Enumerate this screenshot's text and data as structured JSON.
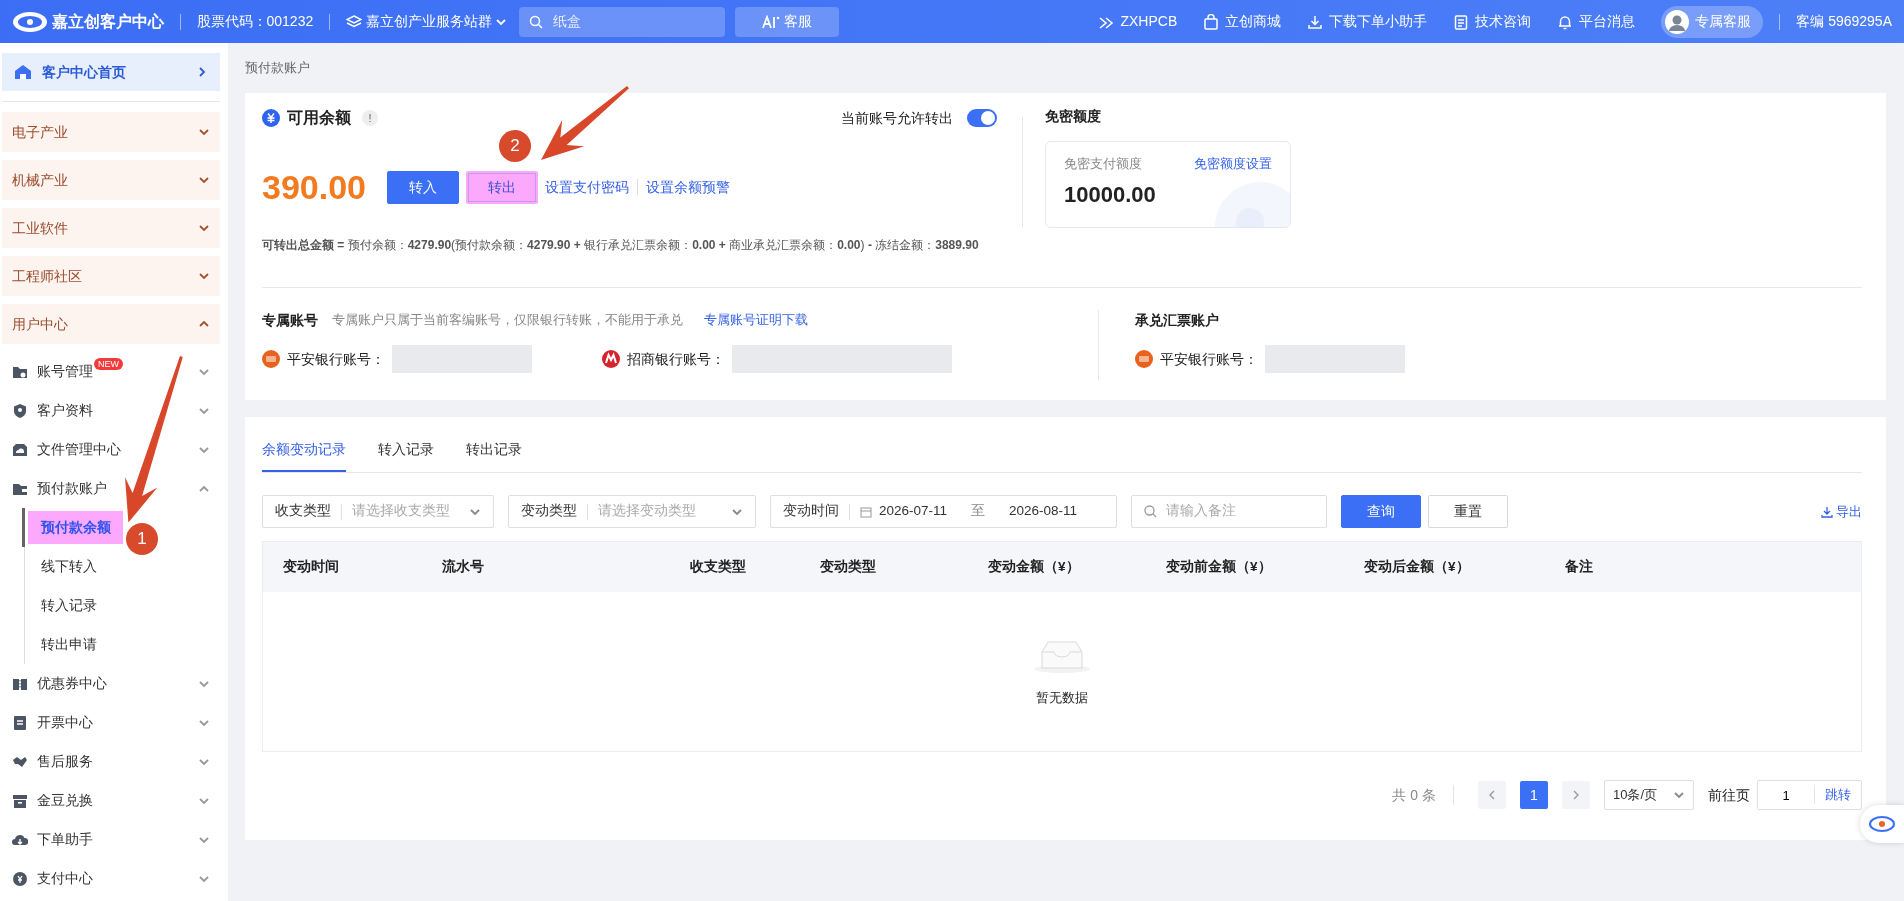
{
  "topbar": {
    "brand": "嘉立创客户中心",
    "stock_code": "股票代码：001232",
    "site_group": "嘉立创产业服务站群",
    "search": {
      "placeholder": "纸盒"
    },
    "ai_button": "客服",
    "links": [
      "ZXHPCB",
      "立创商城",
      "下载下单小助手",
      "技术咨询",
      "平台消息"
    ],
    "service_button": "专属客服",
    "customer_id": "客编 5969295A"
  },
  "sidebar": {
    "home": "客户中心首页",
    "categories": [
      {
        "label": "电子产业",
        "expanded": false
      },
      {
        "label": "机械产业",
        "expanded": false
      },
      {
        "label": "工业软件",
        "expanded": false
      },
      {
        "label": "工程师社区",
        "expanded": false
      },
      {
        "label": "用户中心",
        "expanded": true
      }
    ],
    "items": [
      {
        "label": "账号管理",
        "badge": "NEW",
        "expanded": false
      },
      {
        "label": "客户资料",
        "expanded": false
      },
      {
        "label": "文件管理中心",
        "expanded": false
      },
      {
        "label": "预付款账户",
        "expanded": true,
        "children": [
          {
            "label": "预付款余额",
            "selected": true,
            "highlighted": true
          },
          {
            "label": "线下转入",
            "selected": false,
            "highlighted": false
          },
          {
            "label": "转入记录",
            "selected": false,
            "highlighted": false
          },
          {
            "label": "转出申请",
            "selected": false,
            "highlighted": false
          }
        ]
      },
      {
        "label": "优惠券中心",
        "expanded": false
      },
      {
        "label": "开票中心",
        "expanded": false
      },
      {
        "label": "售后服务",
        "expanded": false
      },
      {
        "label": "金豆兑换",
        "expanded": false
      },
      {
        "label": "下单助手",
        "expanded": false
      },
      {
        "label": "支付中心",
        "expanded": false
      }
    ]
  },
  "breadcrumb": "预付款账户",
  "balance": {
    "title": "可用余额",
    "hint": "!",
    "allow_transfer_label": "当前账号允许转出",
    "allow_transfer_on": true,
    "amount": "390.00",
    "buttons": [
      {
        "label": "转入",
        "kind": "primary",
        "highlighted": false
      },
      {
        "label": "转出",
        "kind": "plain",
        "highlighted": true
      }
    ],
    "links": [
      "设置支付密码",
      "设置余额预警"
    ],
    "formula": "**可转出总金额 =** 预付余额：**4279.90**(预付款余额：**4279.90 +** 银行承兑汇票余额：**0.00 +** 商业承兑汇票余额：**0.00**) **-** 冻结金额：**3889.90**"
  },
  "password_free": {
    "title": "免密额度",
    "label": "免密支付额度",
    "link": "免密额度设置",
    "amount": "10000.00"
  },
  "dedicated_account": {
    "title": "专属账号",
    "note": "专属账户只属于当前客编账号，仅限银行转账，不能用于承兑",
    "link": "专属账号证明下载",
    "banks": [
      {
        "kind": "pingan",
        "label": "平安银行账号："
      },
      {
        "kind": "cmb",
        "label": "招商银行账号："
      }
    ]
  },
  "acceptance_account": {
    "title": "承兑汇票账户",
    "banks": [
      {
        "kind": "pingan",
        "label": "平安银行账号："
      }
    ]
  },
  "records": {
    "tabs": [
      {
        "label": "余额变动记录",
        "selected": true
      },
      {
        "label": "转入记录",
        "selected": false
      },
      {
        "label": "转出记录",
        "selected": false
      }
    ],
    "filters": {
      "selects": [
        {
          "label": "收支类型",
          "placeholder": "请选择收支类型"
        },
        {
          "label": "变动类型",
          "placeholder": "请选择变动类型"
        }
      ],
      "date": {
        "label": "变动时间",
        "start": "2026-07-11",
        "separator": "至",
        "end": "2026-08-11"
      },
      "remark": {
        "placeholder": "请输入备注"
      },
      "search_button": "查询",
      "reset_button": "重置",
      "export": "导出"
    },
    "columns": [
      "变动时间",
      "流水号",
      "收支类型",
      "变动类型",
      "变动金额（¥）",
      "变动前金额（¥）",
      "变动后金额（¥）",
      "备注"
    ],
    "empty_text": "暂无数据",
    "pagination": {
      "total": "共 0 条",
      "pages": [
        {
          "label": "1",
          "selected": true
        }
      ],
      "page_size": "10条/页",
      "goto_label": "前往页",
      "goto_value": "1",
      "goto_button": "跳转"
    }
  },
  "annotations": [
    {
      "number": "1"
    },
    {
      "number": "2"
    }
  ]
}
